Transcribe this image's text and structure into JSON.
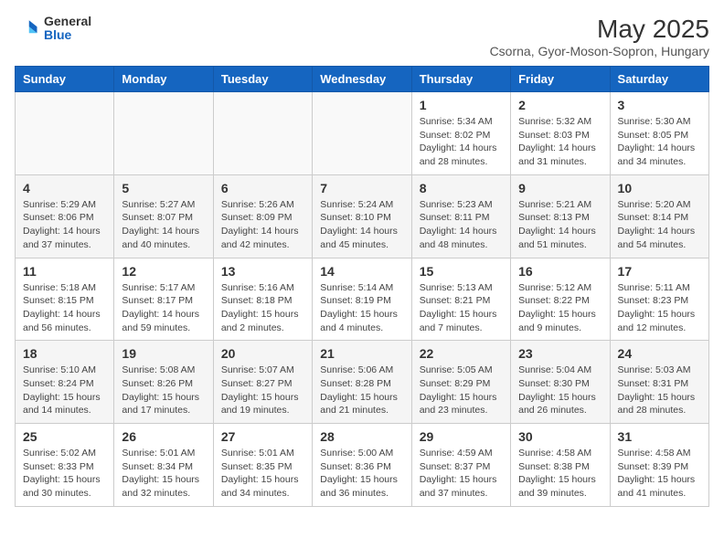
{
  "header": {
    "logo_line1": "General",
    "logo_line2": "Blue",
    "title": "May 2025",
    "subtitle": "Csorna, Gyor-Moson-Sopron, Hungary"
  },
  "weekdays": [
    "Sunday",
    "Monday",
    "Tuesday",
    "Wednesday",
    "Thursday",
    "Friday",
    "Saturday"
  ],
  "weeks": [
    [
      {
        "day": "",
        "info": ""
      },
      {
        "day": "",
        "info": ""
      },
      {
        "day": "",
        "info": ""
      },
      {
        "day": "",
        "info": ""
      },
      {
        "day": "1",
        "info": "Sunrise: 5:34 AM\nSunset: 8:02 PM\nDaylight: 14 hours\nand 28 minutes."
      },
      {
        "day": "2",
        "info": "Sunrise: 5:32 AM\nSunset: 8:03 PM\nDaylight: 14 hours\nand 31 minutes."
      },
      {
        "day": "3",
        "info": "Sunrise: 5:30 AM\nSunset: 8:05 PM\nDaylight: 14 hours\nand 34 minutes."
      }
    ],
    [
      {
        "day": "4",
        "info": "Sunrise: 5:29 AM\nSunset: 8:06 PM\nDaylight: 14 hours\nand 37 minutes."
      },
      {
        "day": "5",
        "info": "Sunrise: 5:27 AM\nSunset: 8:07 PM\nDaylight: 14 hours\nand 40 minutes."
      },
      {
        "day": "6",
        "info": "Sunrise: 5:26 AM\nSunset: 8:09 PM\nDaylight: 14 hours\nand 42 minutes."
      },
      {
        "day": "7",
        "info": "Sunrise: 5:24 AM\nSunset: 8:10 PM\nDaylight: 14 hours\nand 45 minutes."
      },
      {
        "day": "8",
        "info": "Sunrise: 5:23 AM\nSunset: 8:11 PM\nDaylight: 14 hours\nand 48 minutes."
      },
      {
        "day": "9",
        "info": "Sunrise: 5:21 AM\nSunset: 8:13 PM\nDaylight: 14 hours\nand 51 minutes."
      },
      {
        "day": "10",
        "info": "Sunrise: 5:20 AM\nSunset: 8:14 PM\nDaylight: 14 hours\nand 54 minutes."
      }
    ],
    [
      {
        "day": "11",
        "info": "Sunrise: 5:18 AM\nSunset: 8:15 PM\nDaylight: 14 hours\nand 56 minutes."
      },
      {
        "day": "12",
        "info": "Sunrise: 5:17 AM\nSunset: 8:17 PM\nDaylight: 14 hours\nand 59 minutes."
      },
      {
        "day": "13",
        "info": "Sunrise: 5:16 AM\nSunset: 8:18 PM\nDaylight: 15 hours\nand 2 minutes."
      },
      {
        "day": "14",
        "info": "Sunrise: 5:14 AM\nSunset: 8:19 PM\nDaylight: 15 hours\nand 4 minutes."
      },
      {
        "day": "15",
        "info": "Sunrise: 5:13 AM\nSunset: 8:21 PM\nDaylight: 15 hours\nand 7 minutes."
      },
      {
        "day": "16",
        "info": "Sunrise: 5:12 AM\nSunset: 8:22 PM\nDaylight: 15 hours\nand 9 minutes."
      },
      {
        "day": "17",
        "info": "Sunrise: 5:11 AM\nSunset: 8:23 PM\nDaylight: 15 hours\nand 12 minutes."
      }
    ],
    [
      {
        "day": "18",
        "info": "Sunrise: 5:10 AM\nSunset: 8:24 PM\nDaylight: 15 hours\nand 14 minutes."
      },
      {
        "day": "19",
        "info": "Sunrise: 5:08 AM\nSunset: 8:26 PM\nDaylight: 15 hours\nand 17 minutes."
      },
      {
        "day": "20",
        "info": "Sunrise: 5:07 AM\nSunset: 8:27 PM\nDaylight: 15 hours\nand 19 minutes."
      },
      {
        "day": "21",
        "info": "Sunrise: 5:06 AM\nSunset: 8:28 PM\nDaylight: 15 hours\nand 21 minutes."
      },
      {
        "day": "22",
        "info": "Sunrise: 5:05 AM\nSunset: 8:29 PM\nDaylight: 15 hours\nand 23 minutes."
      },
      {
        "day": "23",
        "info": "Sunrise: 5:04 AM\nSunset: 8:30 PM\nDaylight: 15 hours\nand 26 minutes."
      },
      {
        "day": "24",
        "info": "Sunrise: 5:03 AM\nSunset: 8:31 PM\nDaylight: 15 hours\nand 28 minutes."
      }
    ],
    [
      {
        "day": "25",
        "info": "Sunrise: 5:02 AM\nSunset: 8:33 PM\nDaylight: 15 hours\nand 30 minutes."
      },
      {
        "day": "26",
        "info": "Sunrise: 5:01 AM\nSunset: 8:34 PM\nDaylight: 15 hours\nand 32 minutes."
      },
      {
        "day": "27",
        "info": "Sunrise: 5:01 AM\nSunset: 8:35 PM\nDaylight: 15 hours\nand 34 minutes."
      },
      {
        "day": "28",
        "info": "Sunrise: 5:00 AM\nSunset: 8:36 PM\nDaylight: 15 hours\nand 36 minutes."
      },
      {
        "day": "29",
        "info": "Sunrise: 4:59 AM\nSunset: 8:37 PM\nDaylight: 15 hours\nand 37 minutes."
      },
      {
        "day": "30",
        "info": "Sunrise: 4:58 AM\nSunset: 8:38 PM\nDaylight: 15 hours\nand 39 minutes."
      },
      {
        "day": "31",
        "info": "Sunrise: 4:58 AM\nSunset: 8:39 PM\nDaylight: 15 hours\nand 41 minutes."
      }
    ]
  ]
}
